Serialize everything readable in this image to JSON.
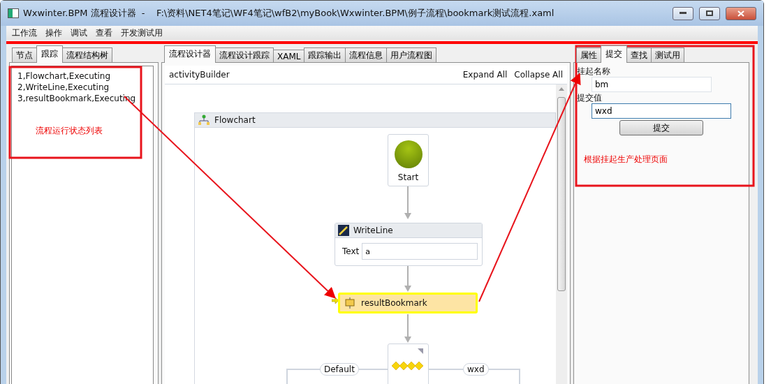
{
  "window": {
    "title": "Wxwinter.BPM 流程设计器  -    F:\\资料\\NET4笔记\\WF4笔记\\wfB2\\myBook\\Wxwinter.BPM\\例子流程\\bookmark测试流程.xaml"
  },
  "menu": [
    "工作流",
    "操作",
    "调试",
    "查看",
    "开发测试用"
  ],
  "left_panel": {
    "tabs": [
      {
        "label": "节点",
        "selected": false
      },
      {
        "label": "跟踪",
        "selected": true
      },
      {
        "label": "流程结构树",
        "selected": false
      }
    ],
    "log_lines": [
      "1,Flowchart,Executing",
      "2,WriteLine,Executing",
      "3,resultBookmark,Executing"
    ],
    "annotation": "流程运行状态列表"
  },
  "designer": {
    "tabs": [
      {
        "label": "流程设计器",
        "selected": true
      },
      {
        "label": "流程设计跟踪",
        "selected": false
      },
      {
        "label": "XAML",
        "selected": false
      },
      {
        "label": "跟踪输出",
        "selected": false
      },
      {
        "label": "流程信息",
        "selected": false
      },
      {
        "label": "用户流程图",
        "selected": false
      }
    ],
    "breadcrumb": "activityBuilder",
    "actions": [
      "Expand All",
      "Collapse All"
    ],
    "flowchart": {
      "title": "Flowchart",
      "nodes": [
        {
          "kind": "start",
          "label": "Start"
        },
        {
          "kind": "activity",
          "title": "WriteLine",
          "field_label": "Text",
          "field_value": "a"
        },
        {
          "kind": "bookmark",
          "title": "resultBookmark",
          "selected": true
        },
        {
          "kind": "switch"
        }
      ],
      "cases": [
        "Default",
        "wxd"
      ]
    }
  },
  "right_panel": {
    "tabs": [
      {
        "label": "属性",
        "selected": false
      },
      {
        "label": "提交",
        "selected": true
      },
      {
        "label": "查找",
        "selected": false
      },
      {
        "label": "测试用",
        "selected": false
      }
    ],
    "fields": [
      {
        "label": "挂起名称",
        "value": "bm",
        "focused": false
      },
      {
        "label": "提交值",
        "value": "wxd",
        "focused": true
      }
    ],
    "button": "提交",
    "annotation": "根据挂起生产处理页面"
  }
}
